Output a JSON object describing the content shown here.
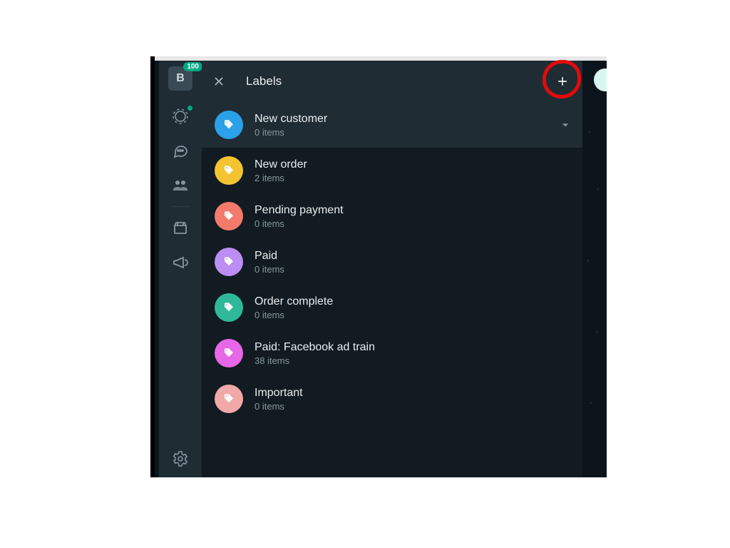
{
  "rail": {
    "badge": "100"
  },
  "header": {
    "title": "Labels"
  },
  "labels": [
    {
      "name": "New customer",
      "sub": "0 items",
      "color": "#2aa1e8",
      "selected": true
    },
    {
      "name": "New order",
      "sub": "2 items",
      "color": "#f4c430",
      "selected": false
    },
    {
      "name": "Pending payment",
      "sub": "0 items",
      "color": "#f47a6b",
      "selected": false
    },
    {
      "name": "Paid",
      "sub": "0 items",
      "color": "#bc8df2",
      "selected": false
    },
    {
      "name": "Order complete",
      "sub": "0 items",
      "color": "#2fb99a",
      "selected": false
    },
    {
      "name": "Paid: Facebook ad train",
      "sub": "38 items",
      "color": "#e866e8",
      "selected": false
    },
    {
      "name": "Important",
      "sub": "0 items",
      "color": "#f2a8a8",
      "selected": false
    }
  ]
}
